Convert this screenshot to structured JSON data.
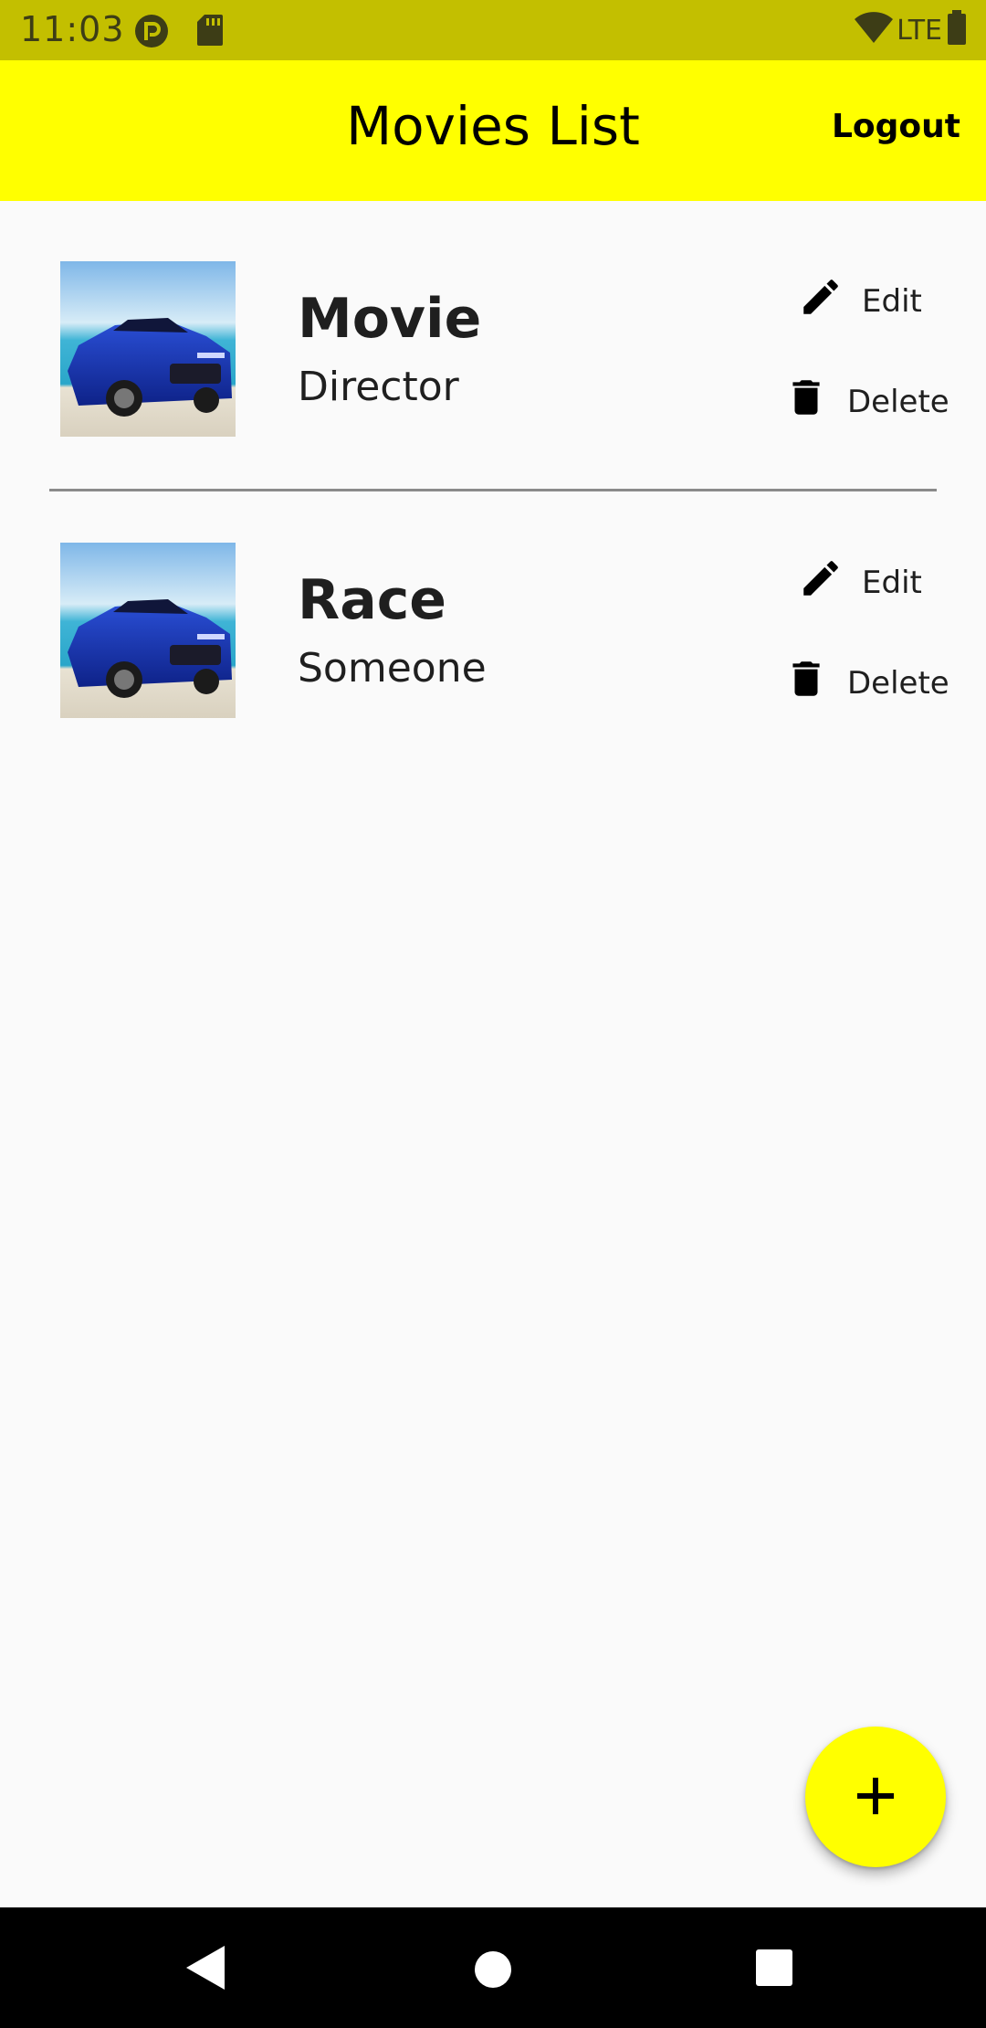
{
  "status_bar": {
    "time": "11:03",
    "network_label": "LTE",
    "icons": [
      "pocket-casts-icon",
      "sd-card-icon",
      "wifi-icon",
      "battery-icon"
    ]
  },
  "app_bar": {
    "title": "Movies List",
    "logout_label": "Logout",
    "background_color": "#ffff00"
  },
  "movies": [
    {
      "title": "Movie",
      "director": "Director",
      "edit_label": "Edit",
      "delete_label": "Delete",
      "thumbnail": "blue-car-photo"
    },
    {
      "title": "Race",
      "director": "Someone",
      "edit_label": "Edit",
      "delete_label": "Delete",
      "thumbnail": "blue-car-photo"
    }
  ],
  "fab": {
    "icon": "plus-icon",
    "color": "#ffff00"
  },
  "nav_bar": {
    "icons": [
      "back-icon",
      "home-icon",
      "recents-icon"
    ]
  }
}
